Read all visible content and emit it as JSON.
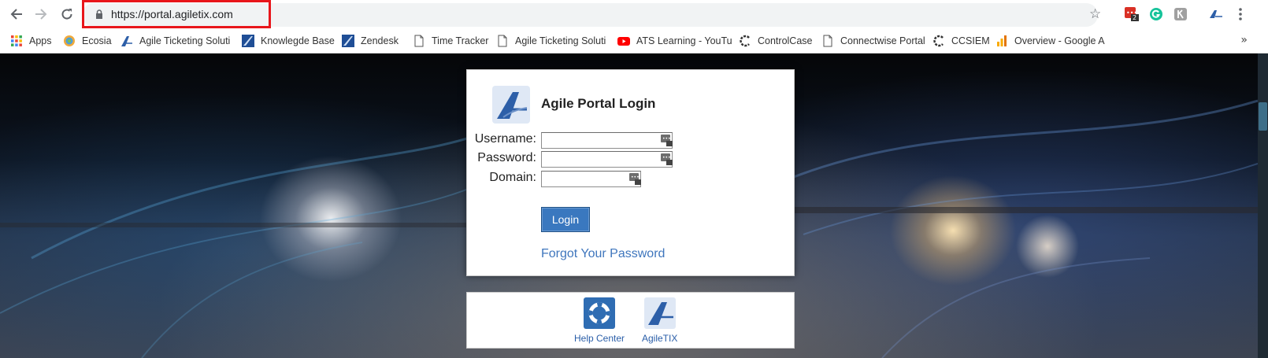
{
  "browser": {
    "url": "https://portal.agiletix.com",
    "extension_badge": "2"
  },
  "bookmarks": {
    "items": [
      {
        "label": "Apps",
        "icon": "apps-grid-icon"
      },
      {
        "label": "Ecosia",
        "icon": "ecosia-icon"
      },
      {
        "label": "Agile Ticketing Soluti",
        "icon": "agile-icon"
      },
      {
        "label": "Knowlegde Base",
        "icon": "agile-icon"
      },
      {
        "label": "Zendesk",
        "icon": "agile-icon"
      },
      {
        "label": "Time Tracker",
        "icon": "page-icon"
      },
      {
        "label": "Agile Ticketing Soluti",
        "icon": "page-icon"
      },
      {
        "label": "ATS Learning - YouTu",
        "icon": "youtube-icon"
      },
      {
        "label": "ControlCase",
        "icon": "controlcase-icon"
      },
      {
        "label": "Connectwise Portal",
        "icon": "page-icon"
      },
      {
        "label": "CCSIEM",
        "icon": "controlcase-icon"
      },
      {
        "label": "Overview - Google A",
        "icon": "analytics-icon"
      }
    ],
    "more": "»"
  },
  "login": {
    "title": "Agile Portal Login",
    "username_label": "Username:",
    "password_label": "Password:",
    "domain_label": "Domain:",
    "username_value": "",
    "password_value": "",
    "domain_value": "",
    "login_button": "Login",
    "forgot_link": "Forgot Your Password"
  },
  "links": {
    "help_center": "Help Center",
    "agiletix": "AgileTIX"
  },
  "colors": {
    "highlight": "#e8161b",
    "login_button": "#3a78bf",
    "link": "#3f76bd"
  }
}
